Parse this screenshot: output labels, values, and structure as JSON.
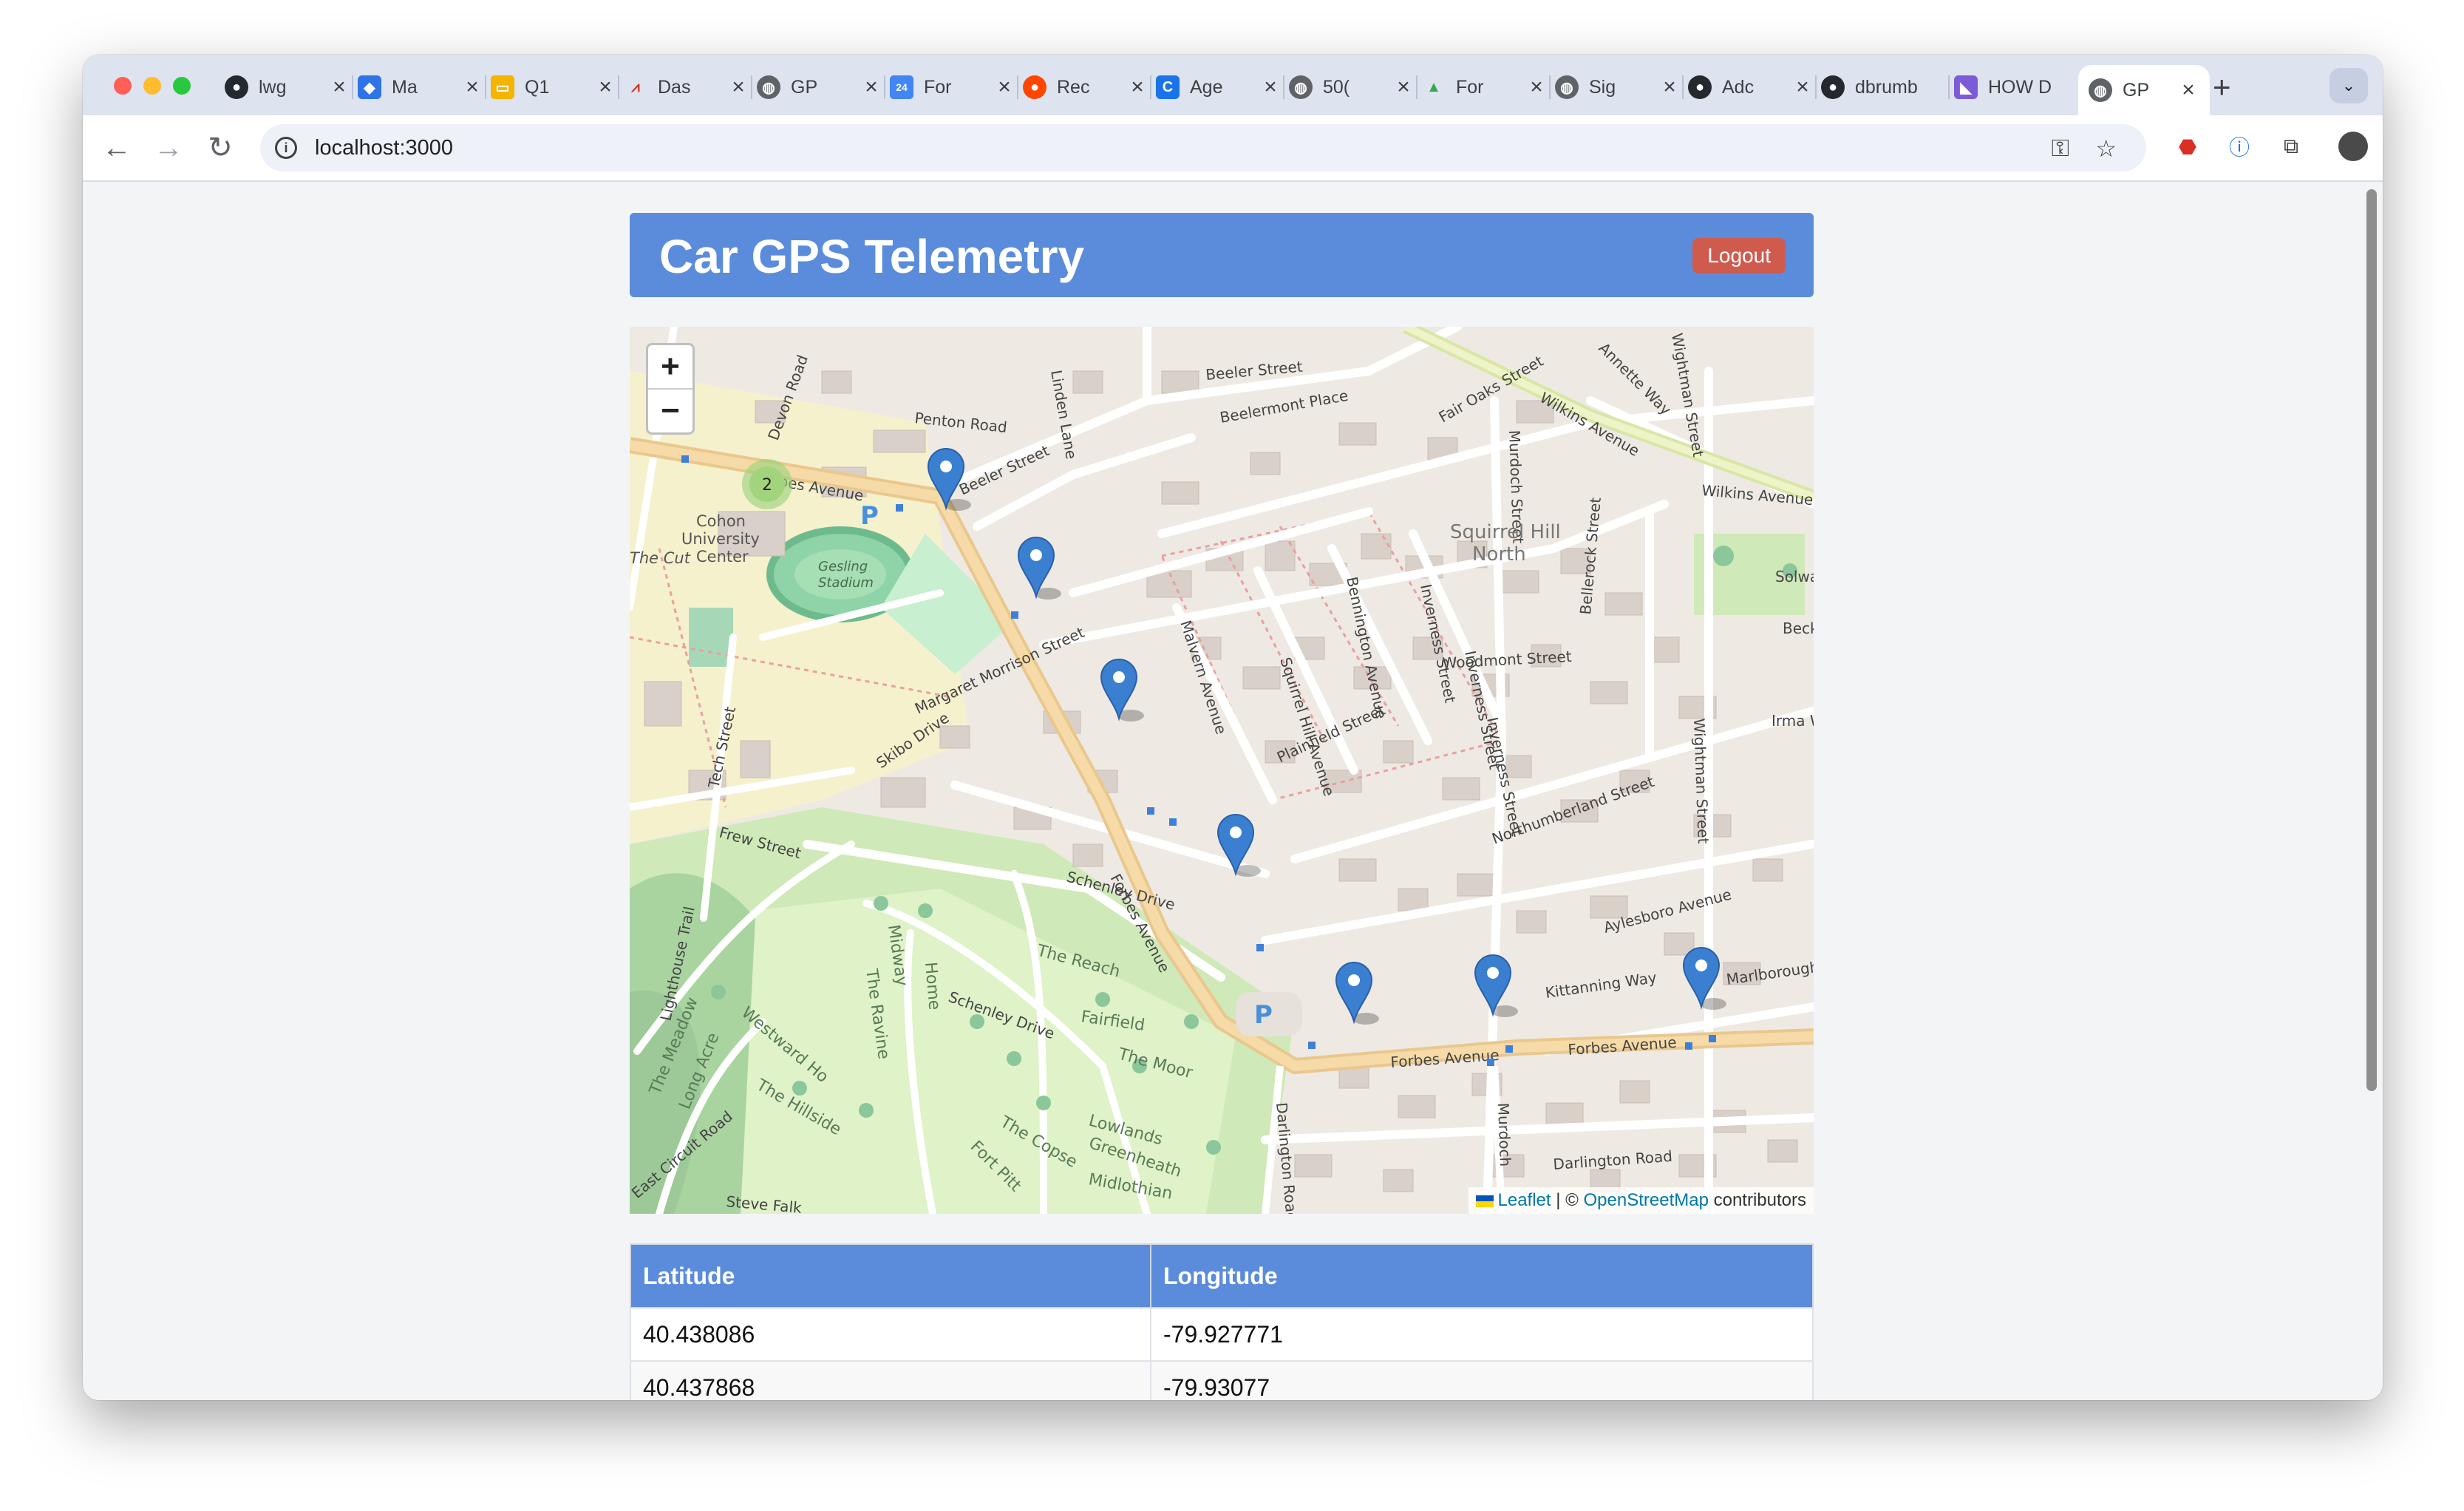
{
  "browser": {
    "tabs": [
      {
        "title": "lwg",
        "icon": "github-icon"
      },
      {
        "title": "Ma",
        "icon": "jira-icon"
      },
      {
        "title": "Q1",
        "icon": "slides-icon"
      },
      {
        "title": "Das",
        "icon": "dashboard-icon"
      },
      {
        "title": "GP",
        "icon": "globe-icon"
      },
      {
        "title": "For",
        "icon": "calendar-icon"
      },
      {
        "title": "Rec",
        "icon": "reddit-icon"
      },
      {
        "title": "Age",
        "icon": "c-icon"
      },
      {
        "title": "50(",
        "icon": "globe-icon"
      },
      {
        "title": "For",
        "icon": "drive-icon"
      },
      {
        "title": "Sig",
        "icon": "globe-icon"
      },
      {
        "title": "Adc",
        "icon": "github-icon"
      },
      {
        "title": "dbrumb",
        "icon": "github-icon"
      },
      {
        "title": "HOW D",
        "icon": "app-icon"
      },
      {
        "title": "GP",
        "icon": "globe-icon"
      }
    ],
    "url": "localhost:3000"
  },
  "app": {
    "title": "Car GPS Telemetry",
    "logout_label": "Logout"
  },
  "map": {
    "zoom_in": "+",
    "zoom_out": "−",
    "cluster_count": "2",
    "attribution": {
      "leaflet": "Leaflet",
      "separator": "| ©",
      "osm": "OpenStreetMap",
      "suffix": "contributors"
    },
    "labels": {
      "forbes_1": "Forbes Avenue",
      "forbes_2": "Forbes Avenue",
      "forbes_3": "Forbes Avenue",
      "forbes_4": "Forbes Avenue",
      "beeler": "Beeler Street",
      "beeler2": "Beeler Street",
      "beelermont": "Beelermont Place",
      "penton": "Penton Road",
      "fairoaks": "Fair Oaks Street",
      "wilkins": "Wilkins Avenue",
      "wilkins2": "Wilkins Avenue",
      "annette": "Annette Way",
      "wightman": "Wightman Street",
      "wightman2": "Wightman Street",
      "squirrel": "Squirrel Hill",
      "north": "North",
      "cohon1": "Cohon",
      "cohon2": "University",
      "cohon3": "Center",
      "gesling1": "Gesling",
      "gesling2": "Stadium",
      "cut": "The Cut",
      "margaret": "Margaret Morrison Street",
      "skibo": "Skibo Drive",
      "tech": "Tech Street",
      "frew": "Frew Street",
      "schenley": "Schenley Drive",
      "schenley2": "Schenley Drive",
      "woodmont": "Woodmont Street",
      "northumberland": "Northumberland Street",
      "aylesboro": "Aylesboro Avenue",
      "kittanning": "Kittanning Way",
      "marlborough": "Marlborough",
      "darlington": "Darlington Road",
      "darlington2": "Darlington Road",
      "reach": "The Reach",
      "fairfield": "Fairfield",
      "moor": "The Moor",
      "lowlands": "Lowlands",
      "greenheath": "Greenheath",
      "midlothian": "Midlothian",
      "copse": "The Copse",
      "fortpitt": "Fort Pitt",
      "hillside": "The Hillside",
      "westwardho": "Westward Ho",
      "meadow": "The Meadow",
      "longacre": "Long Acre",
      "lighthouse": "Lighthouse Trail",
      "ravine": "The Ravine",
      "midway": "Midway",
      "home": "Home",
      "solway": "Solway Str",
      "beckway": "Beck Way",
      "irma": "Irma W",
      "plainfield": "Plainfield Street",
      "bennington": "Bennington Avenue",
      "inverness": "Inverness Street",
      "inverness2": "Inverness Street",
      "inverness3": "Inverness Street",
      "malvern": "Malvern Avenue",
      "squirrelhillave": "Squirrel Hill Avenue",
      "murdoch": "Murdoch Street",
      "murdoch2": "Murdoch",
      "bellerock": "Bellerock Street",
      "devon": "Devon Road",
      "linden": "Linden Lane",
      "steve": "Steve Falk",
      "eastcircuit": "East Circuit Road",
      "parking": "P"
    }
  },
  "table": {
    "headers": [
      "Latitude",
      "Longitude"
    ],
    "rows": [
      [
        "40.438086",
        "-79.927771"
      ],
      [
        "40.437868",
        "-79.93077"
      ]
    ]
  }
}
